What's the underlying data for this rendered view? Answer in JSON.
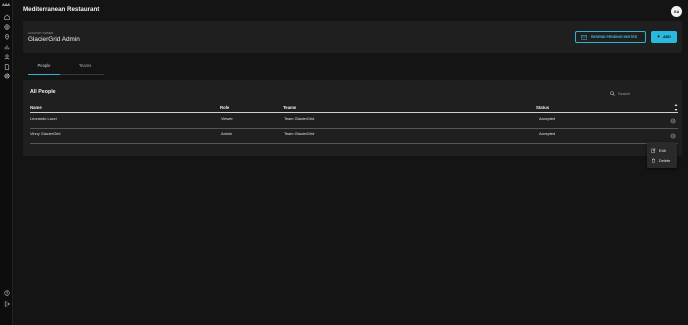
{
  "sidebar": {
    "logo_text": "AAA",
    "items": [
      {
        "icon": "home-icon"
      },
      {
        "icon": "globe-icon"
      },
      {
        "icon": "location-icon"
      },
      {
        "icon": "chart-icon"
      },
      {
        "icon": "user-icon"
      },
      {
        "icon": "document-icon"
      },
      {
        "icon": "gear-icon"
      }
    ],
    "bottom_items": [
      {
        "icon": "help-icon"
      },
      {
        "icon": "logout-icon"
      }
    ]
  },
  "header": {
    "title": "Mediterranean Restaurant",
    "avatar_initials": "GA"
  },
  "account": {
    "label": "ACCOUNT OWNER",
    "name": "GlacierGrid Admin",
    "resend_label": "RESEND PENDING INVITES",
    "add_label": "ADD",
    "add_icon": "+"
  },
  "tabs": [
    {
      "label": "People",
      "active": true
    },
    {
      "label": "Teams",
      "active": false
    }
  ],
  "people": {
    "title": "All People",
    "search_placeholder": "Search",
    "columns": [
      "Name",
      "Role",
      "Teams",
      "Status"
    ],
    "rows": [
      {
        "name": "Leonardo Lazzi",
        "role": "Viewer",
        "teams": "Team GlacierGrid",
        "status": "Accepted"
      },
      {
        "name": "Vinny GlacierGrid",
        "role": "Admin",
        "teams": "Team GlacierGrid",
        "status": "Accepted"
      }
    ]
  },
  "row_menu": {
    "edit_label": "Edit",
    "delete_label": "Delete"
  },
  "colors": {
    "accent": "#2fb3d2",
    "background": "#141414",
    "card": "#1f1f1f"
  }
}
